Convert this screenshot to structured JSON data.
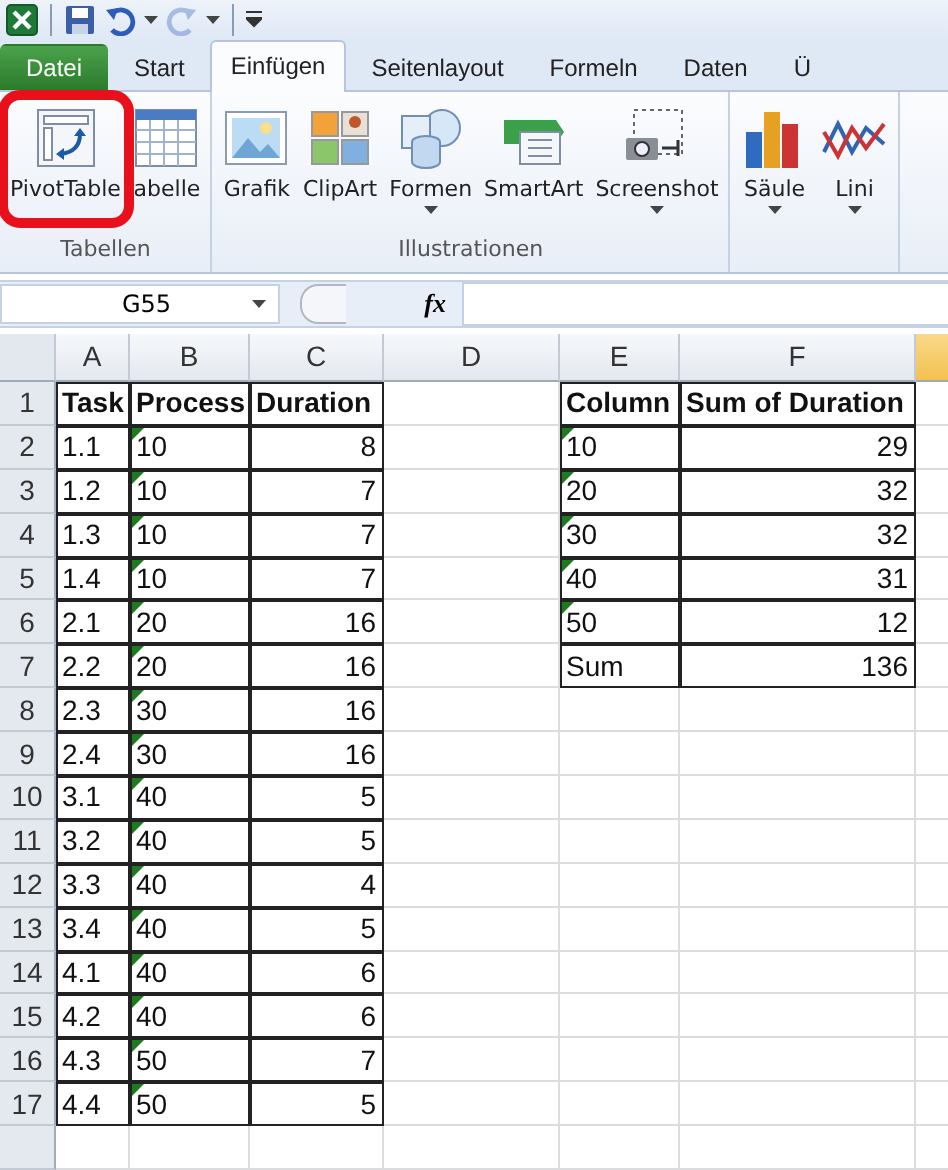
{
  "quick_access": {
    "redo": {
      "disabled": true
    }
  },
  "tabs": [
    {
      "label": "Datei",
      "kind": "file",
      "selected": false
    },
    {
      "label": "Start",
      "kind": "tab",
      "selected": false
    },
    {
      "label": "Einfügen",
      "kind": "tab",
      "selected": true
    },
    {
      "label": "Seitenlayout",
      "kind": "tab",
      "selected": false
    },
    {
      "label": "Formeln",
      "kind": "tab",
      "selected": false
    },
    {
      "label": "Daten",
      "kind": "tab",
      "selected": false
    },
    {
      "label": "Ü",
      "kind": "tab",
      "selected": false
    }
  ],
  "ribbon": {
    "groups": [
      {
        "label": "Tabellen",
        "buttons": [
          {
            "label": "PivotTable",
            "kind": "pivot",
            "highlighted": true,
            "has_menu": false
          },
          {
            "label": "abelle",
            "kind": "table",
            "highlighted": false,
            "has_menu": false
          }
        ]
      },
      {
        "label": "Illustrationen",
        "buttons": [
          {
            "label": "Grafik",
            "kind": "picture",
            "highlighted": false,
            "has_menu": false
          },
          {
            "label": "ClipArt",
            "kind": "clipart",
            "highlighted": false,
            "has_menu": false
          },
          {
            "label": "Formen",
            "kind": "shapes",
            "highlighted": false,
            "has_menu": true
          },
          {
            "label": "SmartArt",
            "kind": "smartart",
            "highlighted": false,
            "has_menu": false
          },
          {
            "label": "Screenshot",
            "kind": "screenshot",
            "highlighted": false,
            "has_menu": true
          }
        ]
      },
      {
        "buttons": [
          {
            "label": "Säule",
            "kind": "column_chart",
            "highlighted": false,
            "has_menu": true
          },
          {
            "label": "Lini",
            "kind": "line_chart",
            "highlighted": false,
            "has_menu": true
          }
        ]
      }
    ]
  },
  "formula_bar": {
    "name_box": "G55",
    "function_label": "fx"
  },
  "sheet": {
    "column_headers": [
      {
        "label": "A",
        "selected": false
      },
      {
        "label": "B",
        "selected": false
      },
      {
        "label": "C",
        "selected": false
      },
      {
        "label": "D",
        "selected": false
      },
      {
        "label": "E",
        "selected": false
      },
      {
        "label": "F",
        "selected": false
      },
      {
        "selected": true
      }
    ],
    "row_headers": [
      "1",
      "2",
      "3",
      "4",
      "5",
      "6",
      "7",
      "8",
      "9",
      "10",
      "11",
      "12",
      "13",
      "14",
      "15",
      "16",
      "17"
    ],
    "data_table": {
      "columns": [
        "Task",
        "Process",
        "Duration"
      ],
      "rows": [
        {
          "task": "1.1",
          "process": "10",
          "duration": "8",
          "marked": true
        },
        {
          "task": "1.2",
          "process": "10",
          "duration": "7",
          "marked": true
        },
        {
          "task": "1.3",
          "process": "10",
          "duration": "7",
          "marked": true
        },
        {
          "task": "1.4",
          "process": "10",
          "duration": "7",
          "marked": true
        },
        {
          "task": "2.1",
          "process": "20",
          "duration": "16",
          "marked": true
        },
        {
          "task": "2.2",
          "process": "20",
          "duration": "16",
          "marked": true
        },
        {
          "task": "2.3",
          "process": "30",
          "duration": "16",
          "marked": true
        },
        {
          "task": "2.4",
          "process": "30",
          "duration": "16",
          "marked": true
        },
        {
          "task": "3.1",
          "process": "40",
          "duration": "5",
          "marked": true
        },
        {
          "task": "3.2",
          "process": "40",
          "duration": "5",
          "marked": true
        },
        {
          "task": "3.3",
          "process": "40",
          "duration": "4",
          "marked": true
        },
        {
          "task": "3.4",
          "process": "40",
          "duration": "5",
          "marked": true
        },
        {
          "task": "4.1",
          "process": "40",
          "duration": "6",
          "marked": true
        },
        {
          "task": "4.2",
          "process": "40",
          "duration": "6",
          "marked": true
        },
        {
          "task": "4.3",
          "process": "50",
          "duration": "7",
          "marked": true
        },
        {
          "task": "4.4",
          "process": "50",
          "duration": "5",
          "marked": true
        }
      ]
    },
    "pivot_table": {
      "columns": [
        "Column",
        "Sum of Duration"
      ],
      "rows": [
        {
          "column": "10",
          "sum": "29",
          "marked": true
        },
        {
          "column": "20",
          "sum": "32",
          "marked": true
        },
        {
          "column": "30",
          "sum": "32",
          "marked": true
        },
        {
          "column": "40",
          "sum": "31",
          "marked": true
        },
        {
          "column": "50",
          "sum": "12",
          "marked": true
        },
        {
          "column": "Sum",
          "sum": "136",
          "marked": false
        }
      ]
    }
  }
}
